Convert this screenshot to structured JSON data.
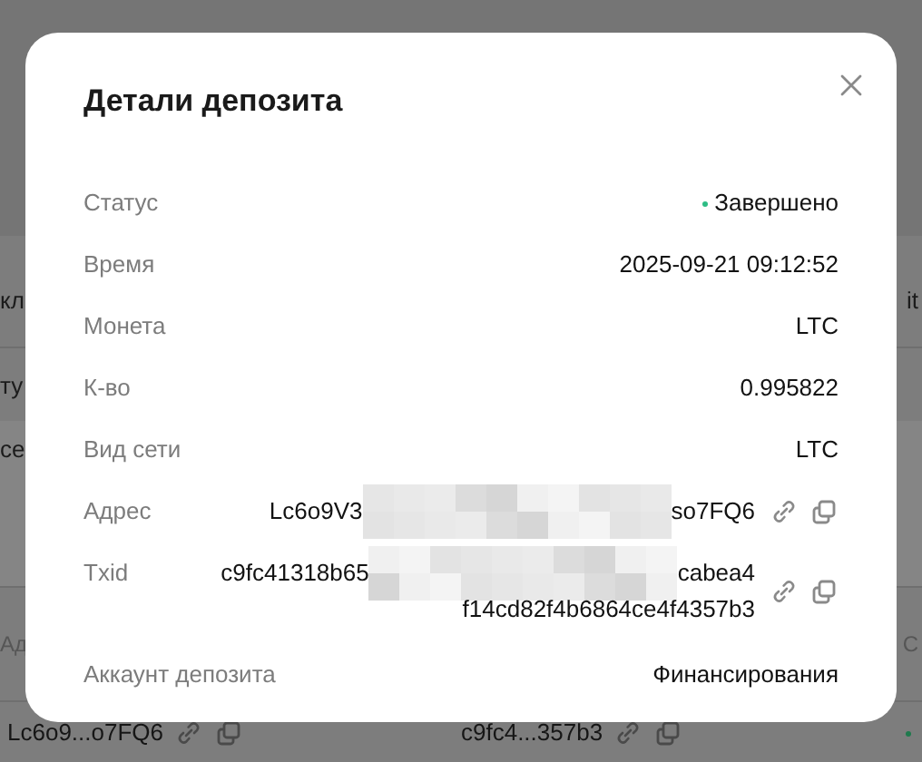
{
  "background_table": {
    "rows": [
      {
        "kind": "plain",
        "cells": [
          "кл",
          "it"
        ]
      },
      {
        "kind": "plain",
        "cells": [
          "ту"
        ]
      },
      {
        "kind": "highlight",
        "cells": [
          "ce"
        ]
      },
      {
        "kind": "header",
        "cells": [
          "Ад",
          "С"
        ]
      },
      {
        "kind": "entry",
        "cells": [
          "Lc6o9...o7FQ6",
          "c9fc4...357b3"
        ],
        "dot": true
      }
    ]
  },
  "modal": {
    "title": "Детали депозита",
    "fields": [
      {
        "kind": "status",
        "label": "Статус",
        "value": "Завершено"
      },
      {
        "kind": "text",
        "label": "Время",
        "value": "2025-09-21 09:12:52"
      },
      {
        "kind": "text",
        "label": "Монета",
        "value": "LTC"
      },
      {
        "kind": "text",
        "label": "К-во",
        "value": "0.995822"
      },
      {
        "kind": "text",
        "label": "Вид сети",
        "value": "LTC"
      },
      {
        "kind": "hash",
        "label": "Адрес",
        "redacted": true,
        "lines": [
          [
            "Lc6o9V3",
            "so7FQ6"
          ]
        ]
      },
      {
        "kind": "hash",
        "label": "Txid",
        "redacted": true,
        "lines": [
          [
            "c9fc41318b65",
            "cabea4"
          ],
          [
            "f14cd82f4b6864ce4f4357b3"
          ]
        ]
      },
      {
        "kind": "text",
        "label": "Аккаунт депозита",
        "value": "Финансирования"
      }
    ]
  }
}
